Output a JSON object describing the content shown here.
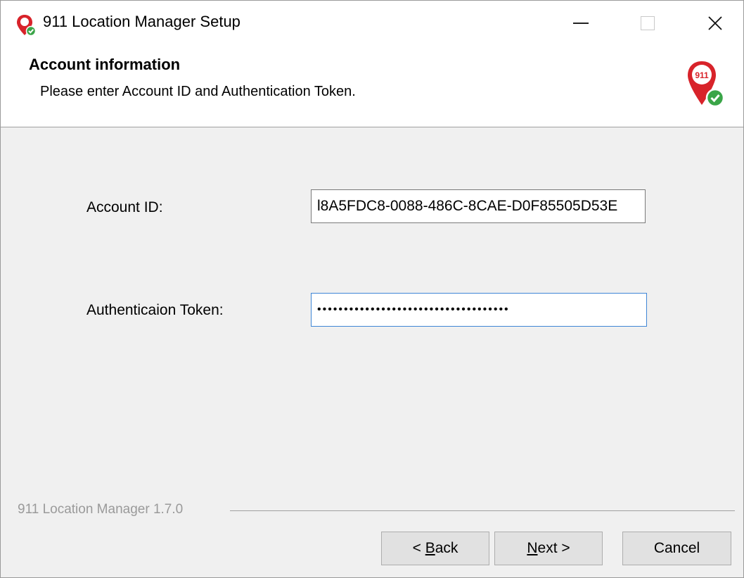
{
  "window": {
    "title": "911 Location Manager Setup",
    "icon": "911-location-pin-icon",
    "controls": [
      "minimize-icon",
      "maximize-icon",
      "close-icon"
    ]
  },
  "header": {
    "title": "Account information",
    "subtitle": "Please enter Account ID and Authentication Token.",
    "logo": "911-location-pin-logo",
    "logo_text": "911"
  },
  "form": {
    "account_id": {
      "label": "Account ID:",
      "value": "l8A5FDC8-0088-486C-8CAE-D0F85505D53E"
    },
    "auth_token": {
      "label": "Authenticaion Token:",
      "masked_value": "••••••••••••••••••••••••••••••••••••"
    }
  },
  "footer": {
    "version": "911 Location Manager 1.7.0",
    "back_prefix": "< ",
    "back_mnemonic": "B",
    "back_rest": "ack",
    "next_mnemonic": "N",
    "next_rest": "ext >",
    "cancel": "Cancel"
  },
  "colors": {
    "pin_red": "#d8232a",
    "check_green": "#3aa548",
    "focus_blue": "#3f86d6",
    "dialog_bg": "#f0f0f0"
  }
}
